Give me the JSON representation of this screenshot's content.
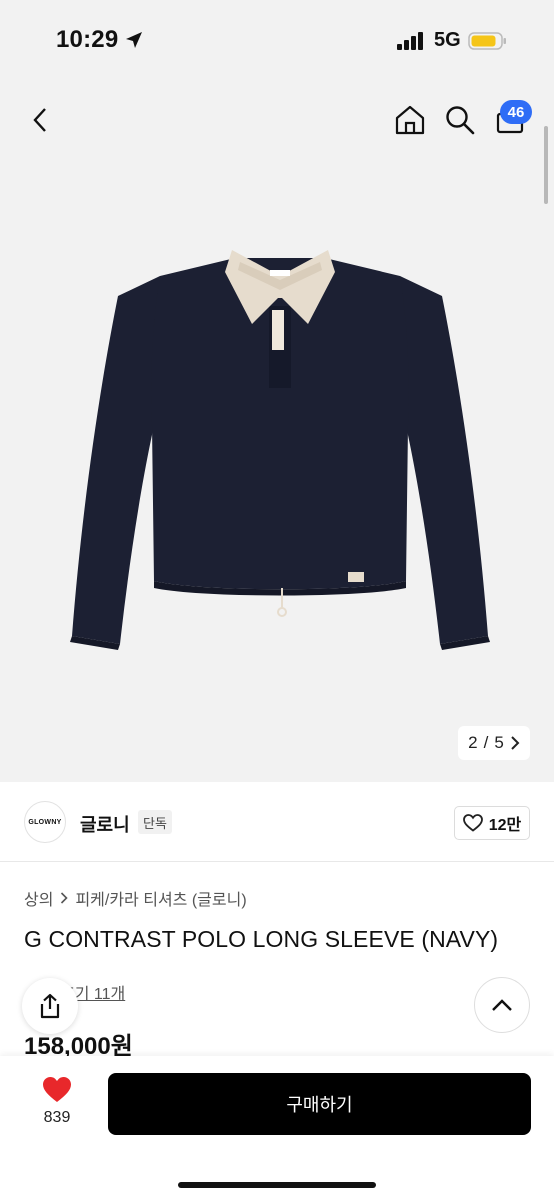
{
  "status_bar": {
    "time": "10:29",
    "network": "5G",
    "icons": [
      "location-arrow-icon",
      "signal-icon",
      "battery-icon"
    ],
    "battery_color": "#f5c518"
  },
  "nav": {
    "cart_badge": "46",
    "icons": [
      "back-icon",
      "home-icon",
      "search-icon",
      "cart-icon"
    ],
    "badge_color": "#2f6df6"
  },
  "gallery": {
    "current": "2",
    "separator": "/",
    "total": "5",
    "product_colors": {
      "body": "#1c2033",
      "collar": "#e6dccd"
    }
  },
  "brand": {
    "logo_text": "GLOWNY",
    "name": "글로니",
    "tag": "단독",
    "likes": "12만"
  },
  "product": {
    "breadcrumb": [
      "상의",
      "피케/카라 티셔츠 (글로니)"
    ],
    "title": "G CONTRAST POLO LONG SLEEVE (NAVY)",
    "review_text": "후기 11개",
    "price": "158,000원"
  },
  "bottom_bar": {
    "wish_count": "839",
    "buy_label": "구매하기",
    "heart_color": "#e8282b"
  }
}
